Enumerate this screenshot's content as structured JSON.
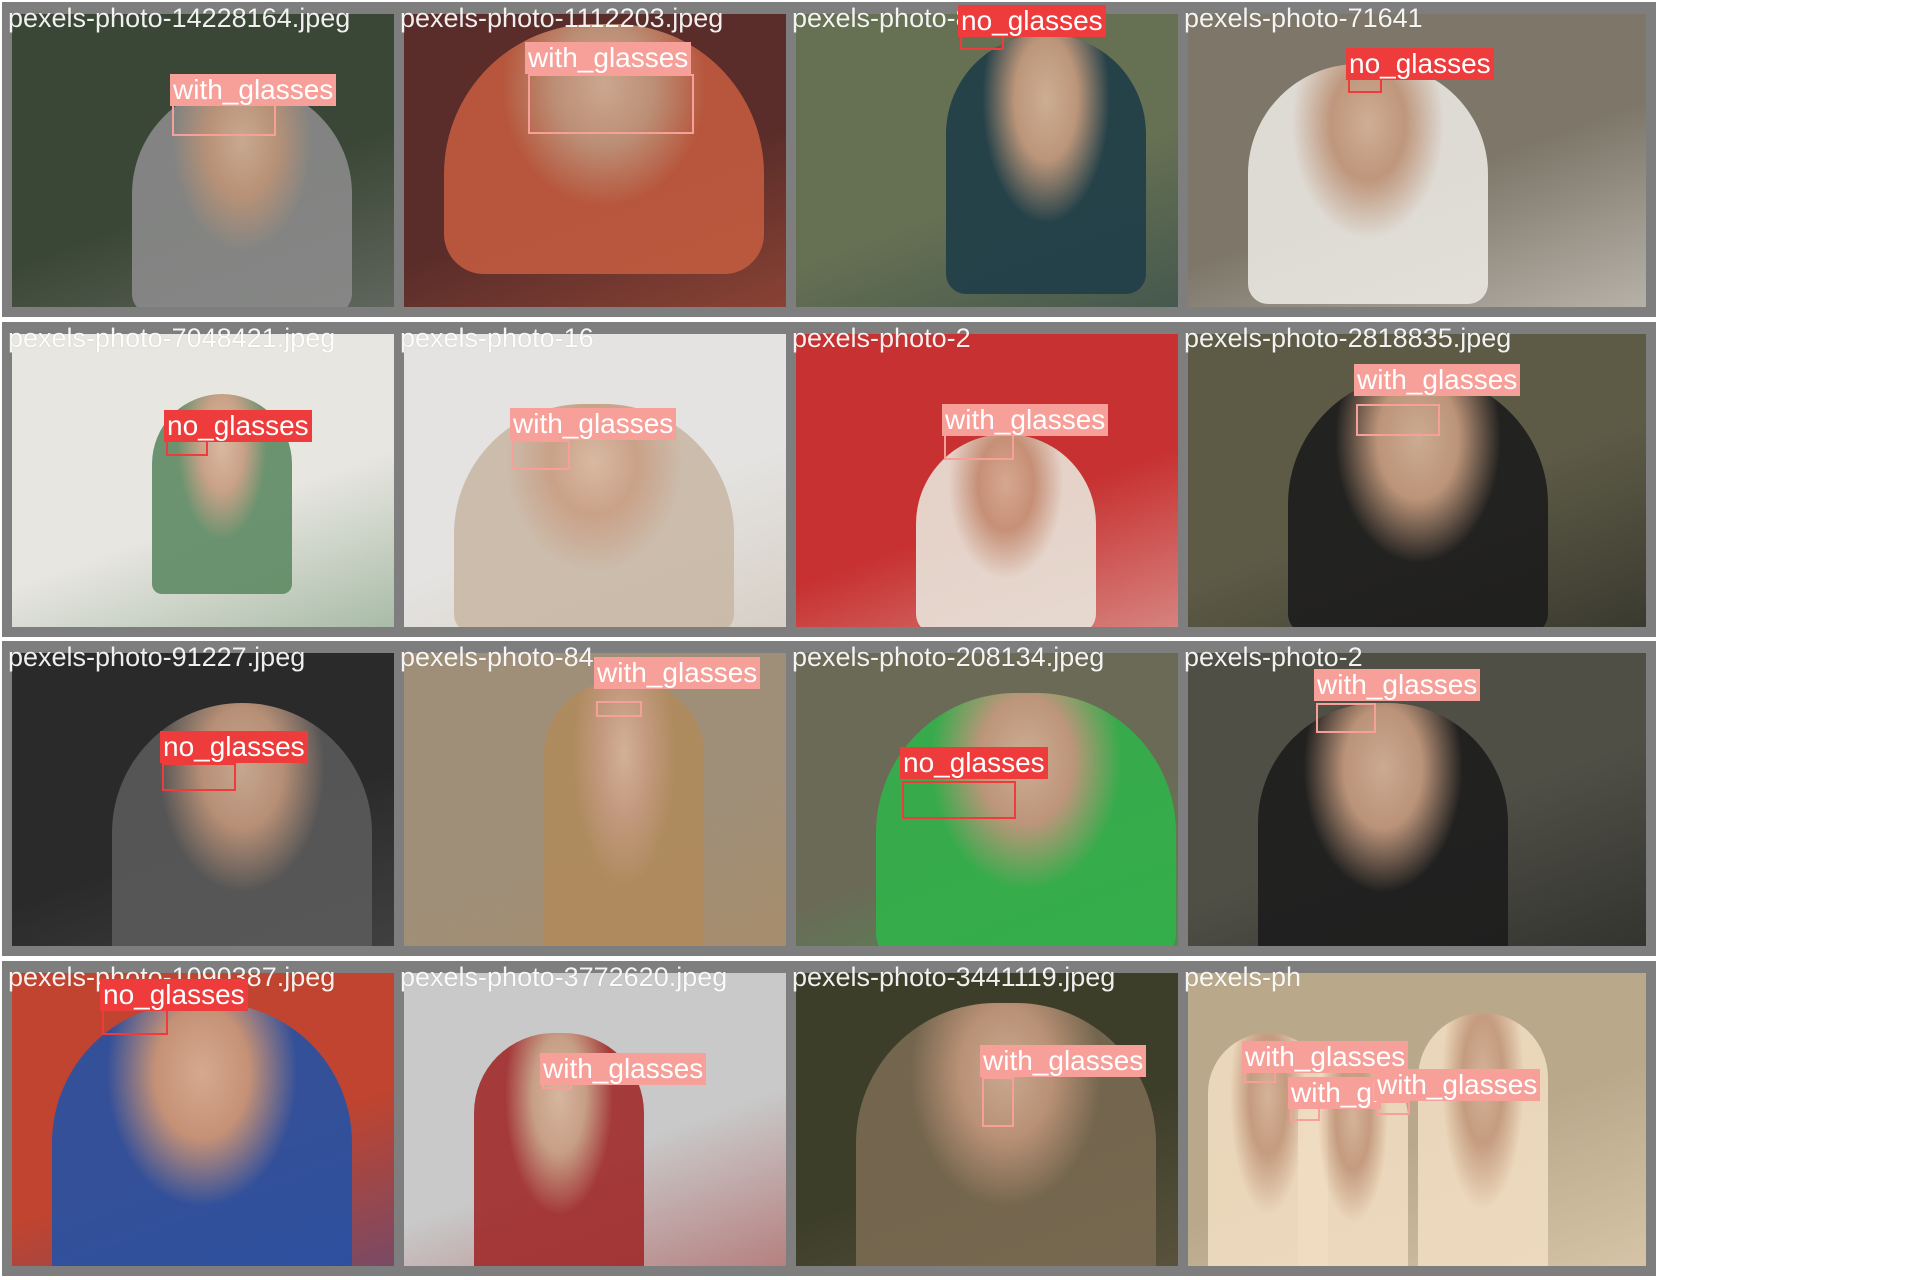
{
  "classes": {
    "with_glasses": {
      "name": "with_glasses",
      "color": "#f7a09a"
    },
    "no_glasses": {
      "name": "no_glasses",
      "color": "#ee3b3b"
    }
  },
  "tiles": [
    {
      "filename": "pexels-photo-14228164.jpeg",
      "background": "#3b4736",
      "accent": "#8a8a8a",
      "detections": [
        {
          "label": "with_glasses"
        }
      ]
    },
    {
      "filename": "pexels-photo-1112203.jpeg",
      "background": "#5a2d2a",
      "accent": "#c15b3f",
      "detections": [
        {
          "label": "with_glasses"
        }
      ]
    },
    {
      "filename": "pexels-photo-8",
      "background": "#667053",
      "accent": "#1f3d48",
      "detections": [
        {
          "label": "no_glasses"
        }
      ]
    },
    {
      "filename": "pexels-photo-71641",
      "background": "#7d7669",
      "accent": "#e9e6e0",
      "detections": [
        {
          "label": "no_glasses"
        }
      ]
    },
    {
      "filename": "pexels-photo-7048421.jpeg",
      "background": "#e8e6e1",
      "accent": "#5e8a63",
      "detections": [
        {
          "label": "no_glasses"
        }
      ]
    },
    {
      "filename": "pexels-photo-16",
      "background": "#e4e3e1",
      "accent": "#c9b8a6",
      "detections": [
        {
          "label": "with_glasses"
        }
      ]
    },
    {
      "filename": "pexels-photo-2",
      "background": "#c73131",
      "accent": "#e8e4da",
      "detections": [
        {
          "label": "with_glasses"
        }
      ]
    },
    {
      "filename": "pexels-photo-2818835.jpeg",
      "background": "#5d5b46",
      "accent": "#1c1c1c",
      "detections": [
        {
          "label": "with_glasses"
        }
      ]
    },
    {
      "filename": "pexels-photo-91227.jpeg",
      "background": "#2a2a2a",
      "accent": "#5a5a5a",
      "detections": [
        {
          "label": "no_glasses"
        }
      ]
    },
    {
      "filename": "pexels-photo-84",
      "background": "#9f8f79",
      "accent": "#b08a5c",
      "detections": [
        {
          "label": "with_glasses"
        }
      ]
    },
    {
      "filename": "pexels-photo-208134.jpeg",
      "background": "#6b6a57",
      "accent": "#31b24a",
      "detections": [
        {
          "label": "no_glasses"
        }
      ]
    },
    {
      "filename": "pexels-photo-2",
      "background": "#4f4f46",
      "accent": "#1c1c1c",
      "detections": [
        {
          "label": "with_glasses"
        }
      ]
    },
    {
      "filename": "pexels-photo-1090387.jpeg",
      "background": "#c0442f",
      "accent": "#2451a5",
      "detections": [
        {
          "label": "no_glasses"
        }
      ]
    },
    {
      "filename": "pexels-photo-3772620.jpeg",
      "background": "#c9c9c9",
      "accent": "#a02a2a",
      "detections": [
        {
          "label": "with_glasses"
        }
      ]
    },
    {
      "filename": "pexels-photo-3441119.jpeg",
      "background": "#3d3e2a",
      "accent": "#7a6a52",
      "detections": [
        {
          "label": "with_glasses"
        }
      ]
    },
    {
      "filename": "pexels-ph",
      "background": "#b9a88a",
      "accent": "#f0dcc0",
      "detections": [
        {
          "label": "with_glasses"
        },
        {
          "label": "with_gl"
        },
        {
          "label": "with_glasses"
        }
      ]
    }
  ]
}
